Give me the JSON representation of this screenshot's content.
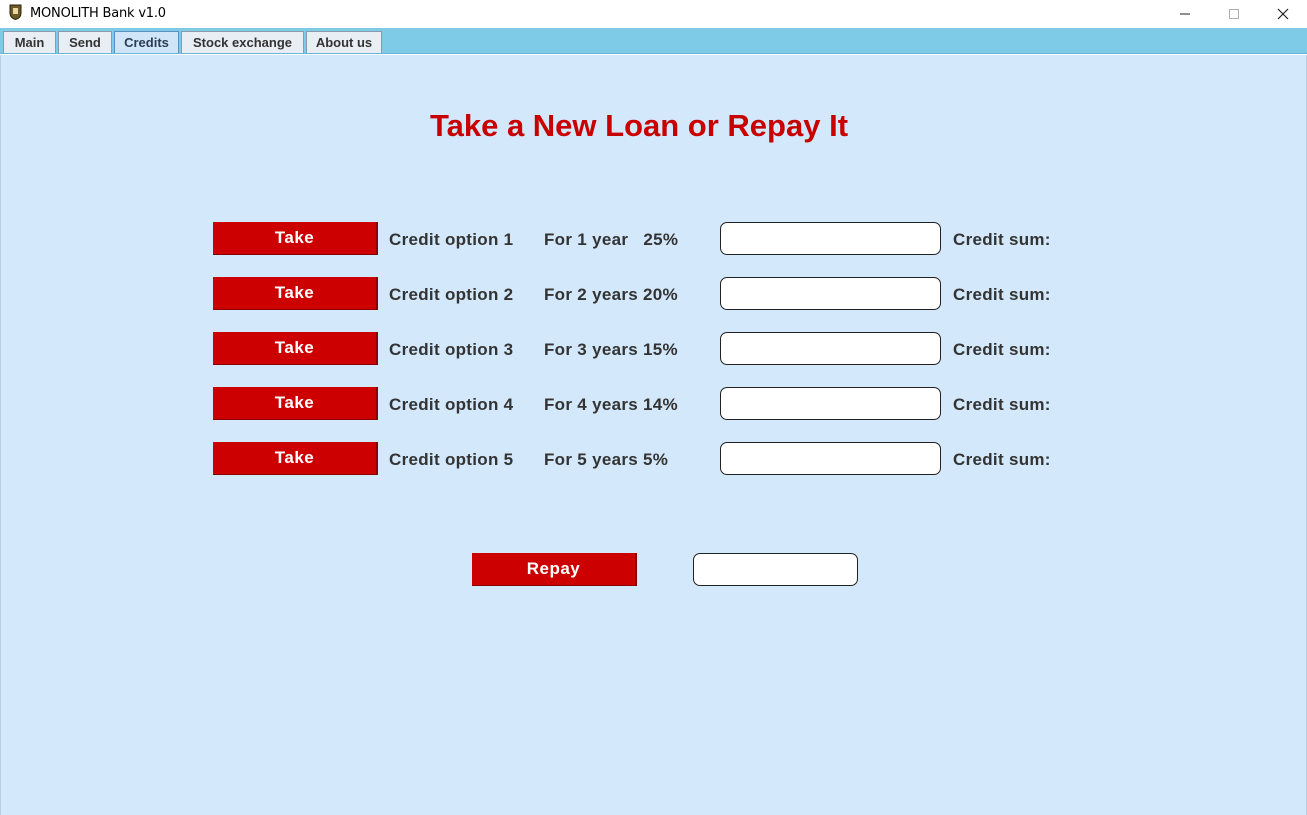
{
  "window": {
    "title": "MONOLITH Bank v1.0",
    "icon": "bank-shield-icon",
    "controls": [
      "minimize-icon",
      "maximize-icon",
      "close-icon"
    ]
  },
  "tabs": [
    {
      "label": "Main",
      "active": false
    },
    {
      "label": "Send",
      "active": false
    },
    {
      "label": "Credits",
      "active": true
    },
    {
      "label": "Stock exchange",
      "active": false
    },
    {
      "label": "About us",
      "active": false
    }
  ],
  "credits": {
    "title": "Take a New Loan or Repay It",
    "take_label": "Take",
    "sum_label": "Credit sum:",
    "options": [
      {
        "name": "Credit option 1",
        "term": "For 1 year   25%",
        "value": ""
      },
      {
        "name": "Credit option 2",
        "term": "For 2 years 20%",
        "value": ""
      },
      {
        "name": "Credit option 3",
        "term": "For 3 years 15%",
        "value": ""
      },
      {
        "name": "Credit option 4",
        "term": "For 4 years 14%",
        "value": ""
      },
      {
        "name": "Credit option 5",
        "term": "For 5 years 5%",
        "value": ""
      }
    ],
    "repay_label": "Repay",
    "repay_value": ""
  },
  "colors": {
    "tab_strip": "#7ecbe8",
    "content_bg": "#d3e8fa",
    "accent_red": "#cc0000",
    "title_red": "#c80000",
    "label_text": "#333333"
  }
}
